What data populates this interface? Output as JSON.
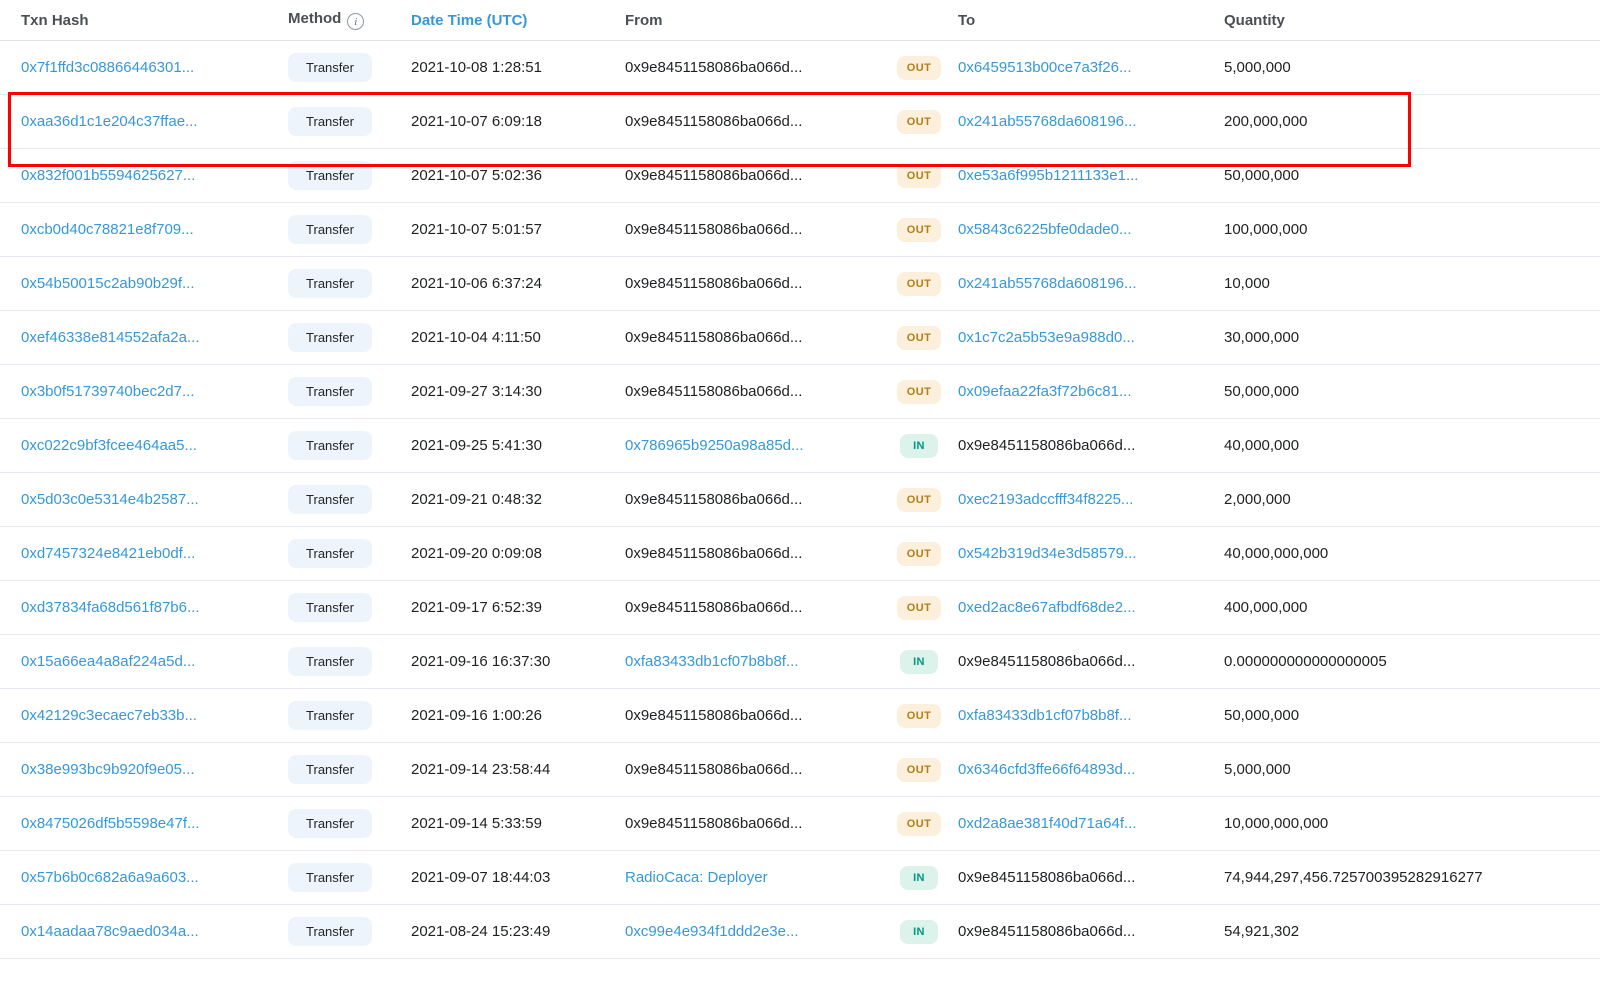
{
  "table": {
    "columns": {
      "txn_hash": "Txn Hash",
      "method": "Method",
      "date_time": "Date Time (UTC)",
      "from": "From",
      "to": "To",
      "quantity": "Quantity"
    },
    "rows": [
      {
        "hash": "0x7f1ffd3c08866446301...",
        "method": "Transfer",
        "datetime": "2021-10-08 1:28:51",
        "from": "0x9e8451158086ba066d...",
        "from_is_link": false,
        "direction": "OUT",
        "to": "0x6459513b00ce7a3f26...",
        "to_is_link": true,
        "quantity": "5,000,000",
        "highlighted": false
      },
      {
        "hash": "0xaa36d1c1e204c37ffae...",
        "method": "Transfer",
        "datetime": "2021-10-07 6:09:18",
        "from": "0x9e8451158086ba066d...",
        "from_is_link": false,
        "direction": "OUT",
        "to": "0x241ab55768da608196...",
        "to_is_link": true,
        "quantity": "200,000,000",
        "highlighted": true
      },
      {
        "hash": "0x832f001b5594625627...",
        "method": "Transfer",
        "datetime": "2021-10-07 5:02:36",
        "from": "0x9e8451158086ba066d...",
        "from_is_link": false,
        "direction": "OUT",
        "to": "0xe53a6f995b1211133e1...",
        "to_is_link": true,
        "quantity": "50,000,000",
        "highlighted": false
      },
      {
        "hash": "0xcb0d40c78821e8f709...",
        "method": "Transfer",
        "datetime": "2021-10-07 5:01:57",
        "from": "0x9e8451158086ba066d...",
        "from_is_link": false,
        "direction": "OUT",
        "to": "0x5843c6225bfe0dade0...",
        "to_is_link": true,
        "quantity": "100,000,000",
        "highlighted": false
      },
      {
        "hash": "0x54b50015c2ab90b29f...",
        "method": "Transfer",
        "datetime": "2021-10-06 6:37:24",
        "from": "0x9e8451158086ba066d...",
        "from_is_link": false,
        "direction": "OUT",
        "to": "0x241ab55768da608196...",
        "to_is_link": true,
        "quantity": "10,000",
        "highlighted": false
      },
      {
        "hash": "0xef46338e814552afa2a...",
        "method": "Transfer",
        "datetime": "2021-10-04 4:11:50",
        "from": "0x9e8451158086ba066d...",
        "from_is_link": false,
        "direction": "OUT",
        "to": "0x1c7c2a5b53e9a988d0...",
        "to_is_link": true,
        "quantity": "30,000,000",
        "highlighted": false
      },
      {
        "hash": "0x3b0f51739740bec2d7...",
        "method": "Transfer",
        "datetime": "2021-09-27 3:14:30",
        "from": "0x9e8451158086ba066d...",
        "from_is_link": false,
        "direction": "OUT",
        "to": "0x09efaa22fa3f72b6c81...",
        "to_is_link": true,
        "quantity": "50,000,000",
        "highlighted": false
      },
      {
        "hash": "0xc022c9bf3fcee464aa5...",
        "method": "Transfer",
        "datetime": "2021-09-25 5:41:30",
        "from": "0x786965b9250a98a85d...",
        "from_is_link": true,
        "direction": "IN",
        "to": "0x9e8451158086ba066d...",
        "to_is_link": false,
        "quantity": "40,000,000",
        "highlighted": false
      },
      {
        "hash": "0x5d03c0e5314e4b2587...",
        "method": "Transfer",
        "datetime": "2021-09-21 0:48:32",
        "from": "0x9e8451158086ba066d...",
        "from_is_link": false,
        "direction": "OUT",
        "to": "0xec2193adccfff34f8225...",
        "to_is_link": true,
        "quantity": "2,000,000",
        "highlighted": false
      },
      {
        "hash": "0xd7457324e8421eb0df...",
        "method": "Transfer",
        "datetime": "2021-09-20 0:09:08",
        "from": "0x9e8451158086ba066d...",
        "from_is_link": false,
        "direction": "OUT",
        "to": "0x542b319d34e3d58579...",
        "to_is_link": true,
        "quantity": "40,000,000,000",
        "highlighted": false
      },
      {
        "hash": "0xd37834fa68d561f87b6...",
        "method": "Transfer",
        "datetime": "2021-09-17 6:52:39",
        "from": "0x9e8451158086ba066d...",
        "from_is_link": false,
        "direction": "OUT",
        "to": "0xed2ac8e67afbdf68de2...",
        "to_is_link": true,
        "quantity": "400,000,000",
        "highlighted": false
      },
      {
        "hash": "0x15a66ea4a8af224a5d...",
        "method": "Transfer",
        "datetime": "2021-09-16 16:37:30",
        "from": "0xfa83433db1cf07b8b8f...",
        "from_is_link": true,
        "direction": "IN",
        "to": "0x9e8451158086ba066d...",
        "to_is_link": false,
        "quantity": "0.000000000000000005",
        "highlighted": false
      },
      {
        "hash": "0x42129c3ecaec7eb33b...",
        "method": "Transfer",
        "datetime": "2021-09-16 1:00:26",
        "from": "0x9e8451158086ba066d...",
        "from_is_link": false,
        "direction": "OUT",
        "to": "0xfa83433db1cf07b8b8f...",
        "to_is_link": true,
        "quantity": "50,000,000",
        "highlighted": false
      },
      {
        "hash": "0x38e993bc9b920f9e05...",
        "method": "Transfer",
        "datetime": "2021-09-14 23:58:44",
        "from": "0x9e8451158086ba066d...",
        "from_is_link": false,
        "direction": "OUT",
        "to": "0x6346cfd3ffe66f64893d...",
        "to_is_link": true,
        "quantity": "5,000,000",
        "highlighted": false
      },
      {
        "hash": "0x8475026df5b5598e47f...",
        "method": "Transfer",
        "datetime": "2021-09-14 5:33:59",
        "from": "0x9e8451158086ba066d...",
        "from_is_link": false,
        "direction": "OUT",
        "to": "0xd2a8ae381f40d71a64f...",
        "to_is_link": true,
        "quantity": "10,000,000,000",
        "highlighted": false
      },
      {
        "hash": "0x57b6b0c682a6a9a603...",
        "method": "Transfer",
        "datetime": "2021-09-07 18:44:03",
        "from": "RadioCaca: Deployer",
        "from_is_link": true,
        "direction": "IN",
        "to": "0x9e8451158086ba066d...",
        "to_is_link": false,
        "quantity": "74,944,297,456.725700395282916277",
        "highlighted": false
      },
      {
        "hash": "0x14aadaa78c9aed034a...",
        "method": "Transfer",
        "datetime": "2021-08-24 15:23:49",
        "from": "0xc99e4e934f1ddd2e3e...",
        "from_is_link": true,
        "direction": "IN",
        "to": "0x9e8451158086ba066d...",
        "to_is_link": false,
        "quantity": "54,921,302",
        "highlighted": false
      }
    ]
  },
  "icons": {
    "method_info": "info-circle"
  },
  "colors": {
    "link_blue": "#3498db",
    "text": "#1e2022",
    "header_text": "#4a4f55",
    "row_border": "#e7eaf3",
    "method_badge_bg": "#edf4fc",
    "out_badge_bg": "#fcf0dd",
    "out_badge_text": "#b47d13",
    "in_badge_bg": "#dcf3ec",
    "in_badge_text": "#02977e",
    "highlight_red": "#fe0000"
  }
}
